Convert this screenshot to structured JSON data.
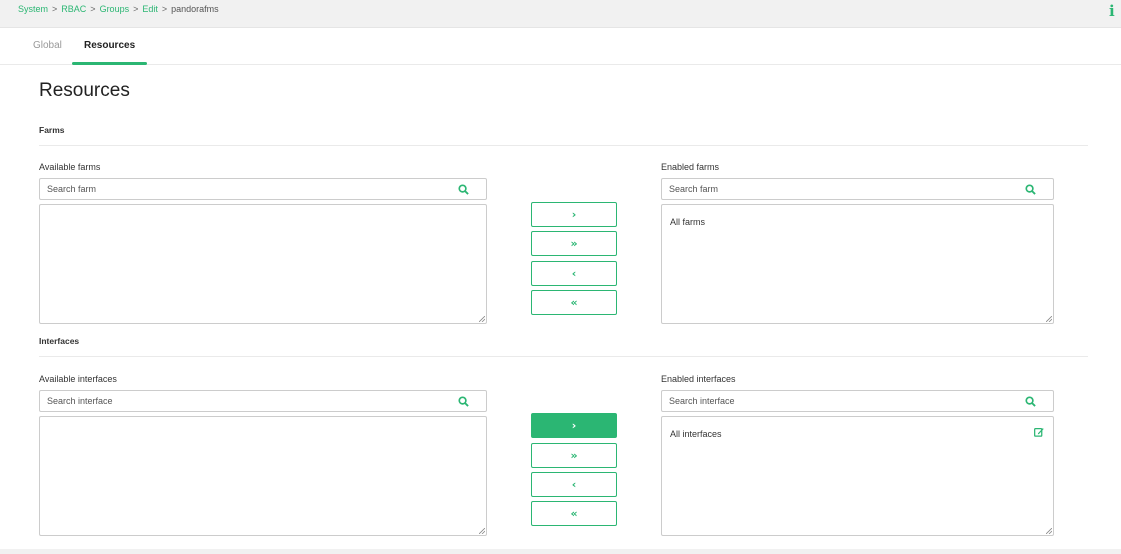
{
  "breadcrumb": {
    "items": [
      "System",
      "RBAC",
      "Groups",
      "Edit"
    ],
    "current": "pandorafms",
    "separator": ">"
  },
  "info_icon": "i",
  "tabs": [
    {
      "label": "Global",
      "active": false
    },
    {
      "label": "Resources",
      "active": true
    }
  ],
  "page_title": "Resources",
  "farms": {
    "section_label": "Farms",
    "available_label": "Available farms",
    "available_placeholder": "Search farm",
    "available_items": [],
    "enabled_label": "Enabled farms",
    "enabled_placeholder": "Search farm",
    "enabled_items": [
      "All farms"
    ],
    "buttons": [
      "›",
      "»",
      "‹",
      "«"
    ]
  },
  "interfaces": {
    "section_label": "Interfaces",
    "available_label": "Available interfaces",
    "available_placeholder": "Search interface",
    "available_items": [],
    "enabled_label": "Enabled interfaces",
    "enabled_placeholder": "Search interface",
    "enabled_items": [
      "All interfaces"
    ],
    "buttons": [
      "›",
      "»",
      "‹",
      "«"
    ]
  },
  "colors": {
    "accent": "#2bb673",
    "background": "#f1f1f1",
    "panel": "#ffffff"
  },
  "icons": [
    "info-icon",
    "search-icon",
    "edit-icon"
  ]
}
